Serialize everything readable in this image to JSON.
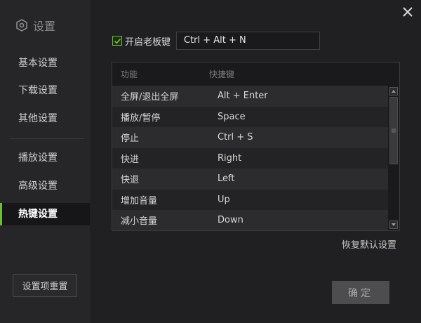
{
  "sidebar": {
    "title": "设置",
    "title_icon": "gear-icon",
    "items": [
      {
        "label": "基本设置",
        "active": false
      },
      {
        "label": "下载设置",
        "active": false
      },
      {
        "label": "其他设置",
        "active": false
      },
      {
        "label": "播放设置",
        "active": false
      },
      {
        "label": "高级设置",
        "active": false
      },
      {
        "label": "热键设置",
        "active": true
      }
    ],
    "reset_label": "设置项重置"
  },
  "boss_key": {
    "checked": true,
    "label": "开启老板键",
    "value": "Ctrl + Alt + N"
  },
  "hotkeys": {
    "columns": [
      "功能",
      "快捷键"
    ],
    "rows": [
      {
        "func": "全屏/退出全屏",
        "key": "Alt + Enter"
      },
      {
        "func": "播放/暂停",
        "key": "Space"
      },
      {
        "func": "停止",
        "key": "Ctrl + S"
      },
      {
        "func": "快进",
        "key": "Right"
      },
      {
        "func": "快退",
        "key": "Left"
      },
      {
        "func": "增加音量",
        "key": "Up"
      },
      {
        "func": "减小音量",
        "key": "Down"
      }
    ]
  },
  "restore_label": "恢复默认设置",
  "ok_label": "确定",
  "colors": {
    "accent": "#6abf2e",
    "background": "#202022",
    "sidebar": "#262628"
  }
}
